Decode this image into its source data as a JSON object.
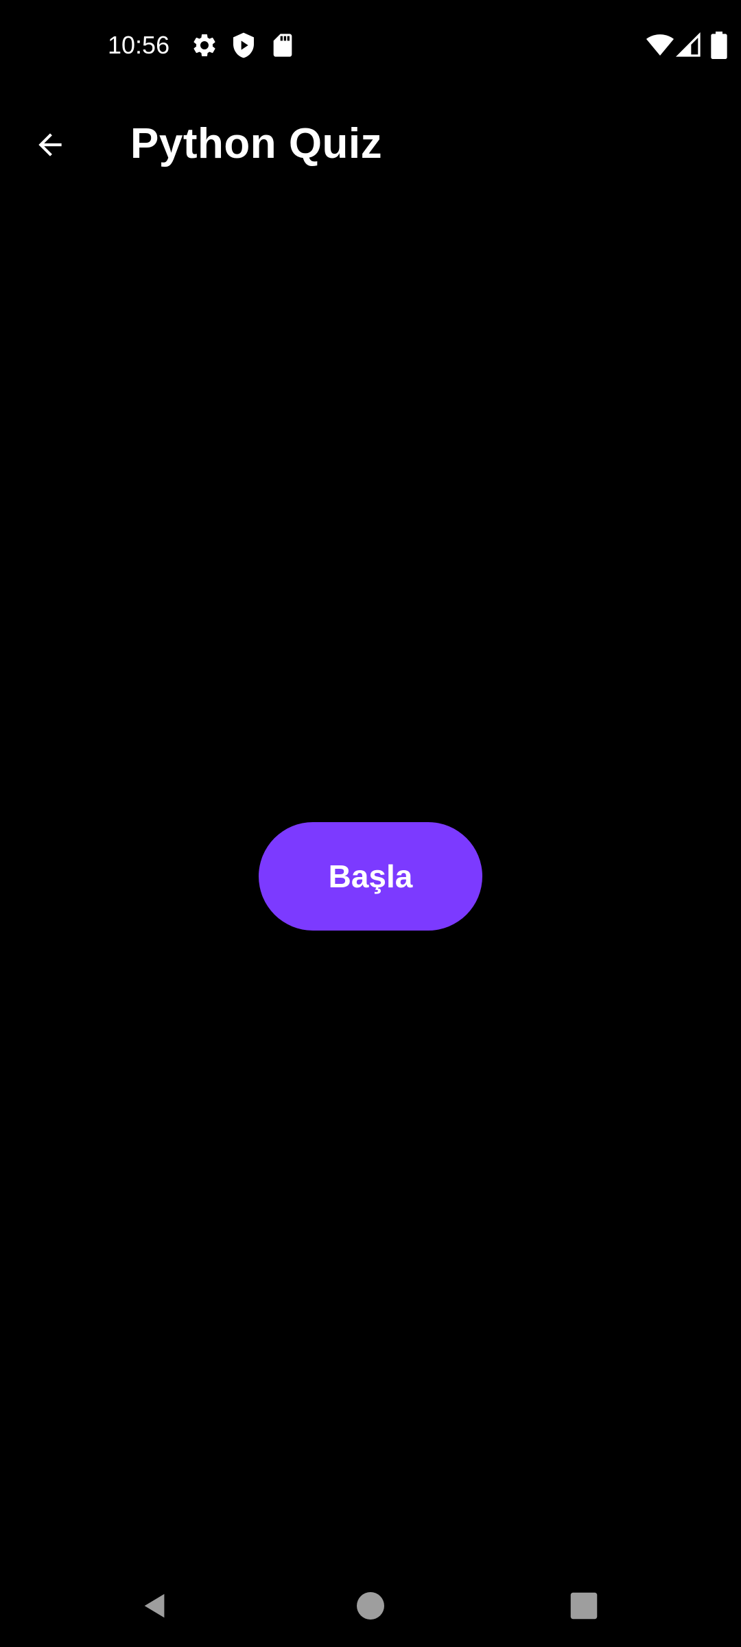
{
  "status_bar": {
    "time": "10:56",
    "icons_left": [
      "settings-icon",
      "play-protect-icon",
      "sd-card-icon"
    ],
    "icons_right": [
      "wifi-icon",
      "cellular-signal-icon",
      "battery-icon"
    ]
  },
  "app_bar": {
    "back_icon": "arrow-back-icon",
    "title": "Python Quiz"
  },
  "main": {
    "start_button_label": "Başla",
    "start_button_color": "#7c3aff"
  },
  "nav_bar": {
    "buttons": [
      "back-triangle-icon",
      "home-circle-icon",
      "recents-square-icon"
    ]
  },
  "colors": {
    "background": "#000000",
    "text": "#ffffff",
    "accent": "#7c3aff",
    "nav_icons": "#9e9e9e"
  }
}
